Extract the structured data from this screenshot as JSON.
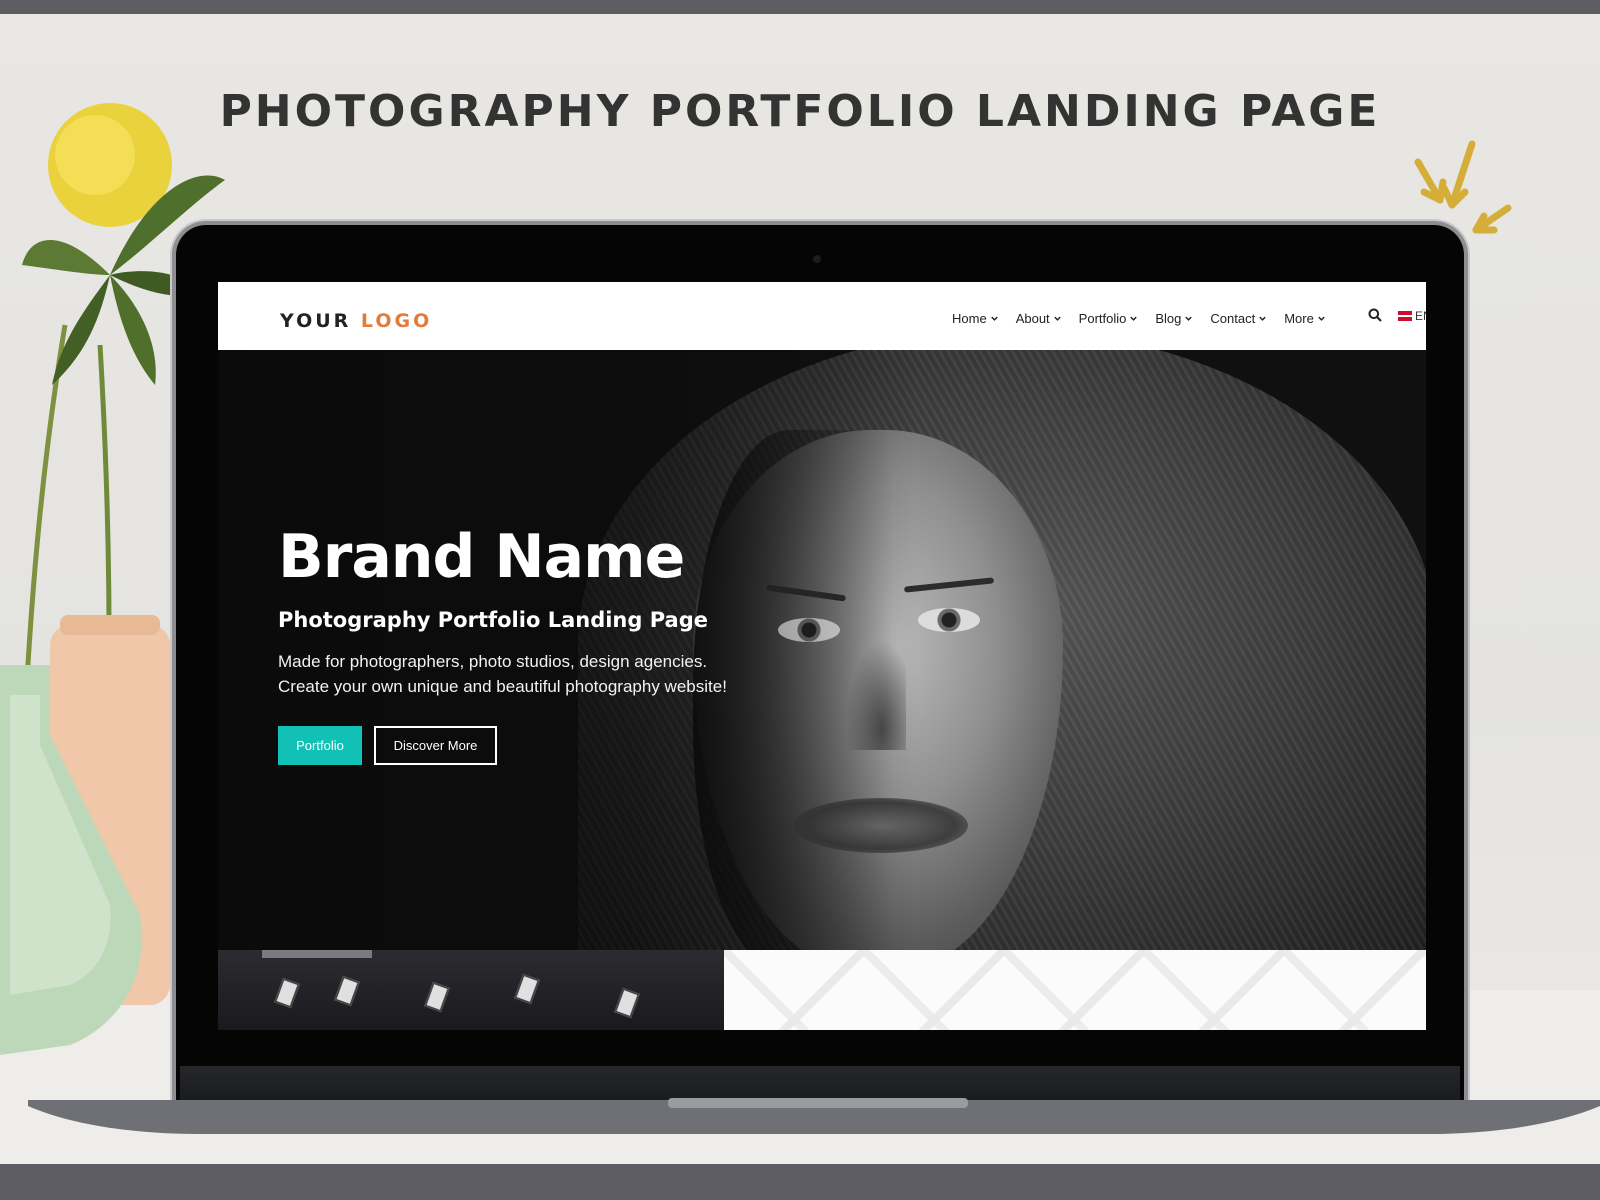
{
  "headline": "PHOTOGRAPHY PORTFOLIO LANDING PAGE",
  "site": {
    "logo": {
      "part1": "YOUR",
      "part2": "LOGO"
    },
    "nav": [
      "Home",
      "About",
      "Portfolio",
      "Blog",
      "Contact",
      "More"
    ],
    "language": "EN"
  },
  "hero": {
    "title": "Brand Name",
    "subtitle": "Photography Portfolio Landing Page",
    "line1": "Made for photographers, photo studios, design agencies.",
    "line2": "Create your own unique and beautiful photography website!",
    "primary_button": "Portfolio",
    "secondary_button": "Discover More"
  },
  "colors": {
    "accent": "#12c1b5",
    "logo_accent": "#e47b3b",
    "arrows": "#d5ae3a",
    "frame": "#5d5c63"
  },
  "icons": [
    "search-icon",
    "chevron-down-icon",
    "flag-icon",
    "arrows-icon"
  ]
}
